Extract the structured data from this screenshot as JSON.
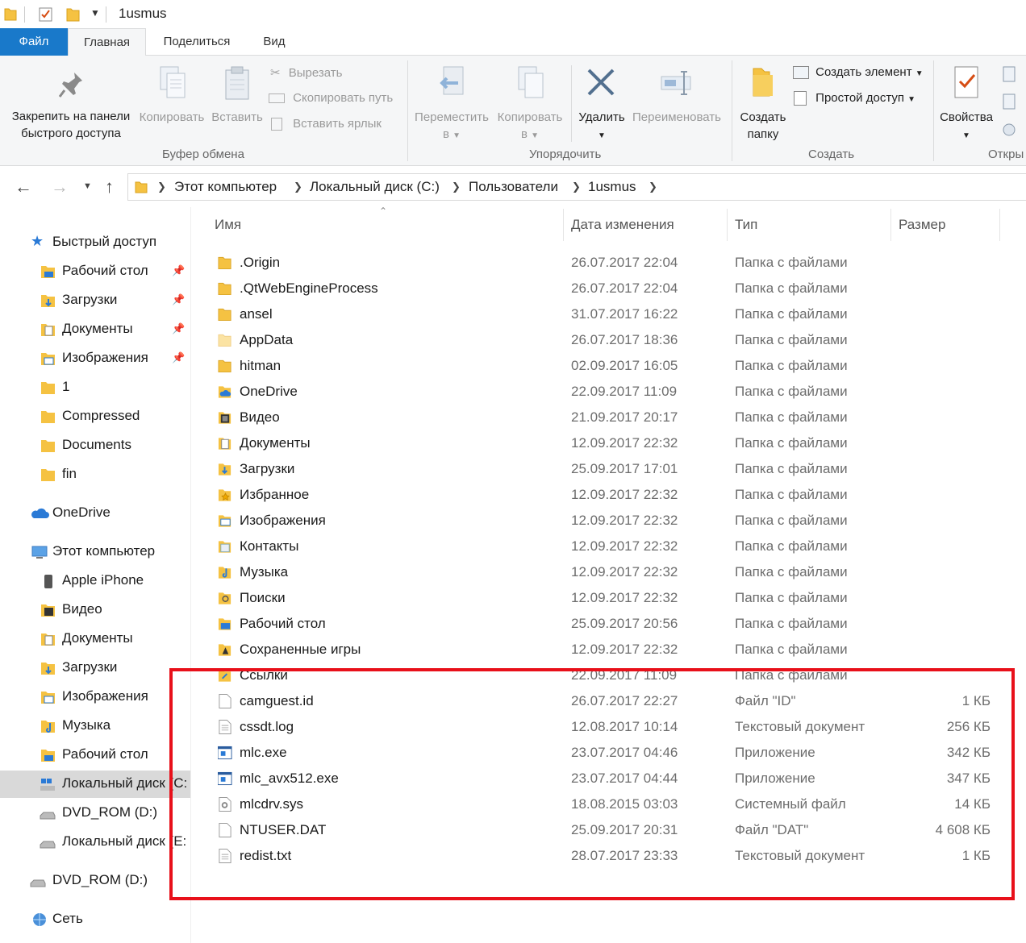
{
  "window": {
    "title": "1usmus"
  },
  "ribbon_tabs": [
    "Файл",
    "Главная",
    "Поделиться",
    "Вид"
  ],
  "ribbon": {
    "pin_label": [
      "Закрепить на панели",
      "быстрого доступа"
    ],
    "copy": "Копировать",
    "paste": "Вставить",
    "cut": "Вырезать",
    "copy_path": "Скопировать путь",
    "paste_shortcut": "Вставить ярлык",
    "group_clipboard": "Буфер обмена",
    "move_to": [
      "Переместить",
      "в"
    ],
    "copy_to": [
      "Копировать",
      "в"
    ],
    "delete": "Удалить",
    "rename": "Переименовать",
    "group_organize": "Упорядочить",
    "new_folder": [
      "Создать",
      "папку"
    ],
    "new_item": "Создать элемент",
    "easy_access": "Простой доступ",
    "group_new": "Создать",
    "properties": "Свойства",
    "group_open": "Откры"
  },
  "breadcrumb": [
    "Этот компьютер",
    "Локальный диск (C:)",
    "Пользователи",
    "1usmus"
  ],
  "nav": {
    "quick_access": "Быстрый доступ",
    "quick_items": [
      "Рабочий стол",
      "Загрузки",
      "Документы",
      "Изображения",
      "1",
      "Compressed",
      "Documents",
      "fin"
    ],
    "onedrive": "OneDrive",
    "this_pc": "Этот компьютер",
    "pc_items": [
      "Apple iPhone",
      "Видео",
      "Документы",
      "Загрузки",
      "Изображения",
      "Музыка",
      "Рабочий стол",
      "Локальный диск (C:",
      "DVD_ROM (D:)",
      "Локальный диск (E:"
    ],
    "dvd": "DVD_ROM (D:)",
    "network": "Сеть"
  },
  "columns": {
    "name": "Имя",
    "date": "Дата изменения",
    "type": "Тип",
    "size": "Размер"
  },
  "files": [
    {
      "name": ".Origin",
      "date": "26.07.2017 22:04",
      "type": "Папка с файлами",
      "size": "",
      "icon": "folder-icon"
    },
    {
      "name": ".QtWebEngineProcess",
      "date": "26.07.2017 22:04",
      "type": "Папка с файлами",
      "size": "",
      "icon": "folder-icon"
    },
    {
      "name": "ansel",
      "date": "31.07.2017 16:22",
      "type": "Папка с файлами",
      "size": "",
      "icon": "folder-icon"
    },
    {
      "name": "AppData",
      "date": "26.07.2017 18:36",
      "type": "Папка с файлами",
      "size": "",
      "icon": "folder-hidden-icon"
    },
    {
      "name": "hitman",
      "date": "02.09.2017 16:05",
      "type": "Папка с файлами",
      "size": "",
      "icon": "folder-icon"
    },
    {
      "name": "OneDrive",
      "date": "22.09.2017 11:09",
      "type": "Папка с файлами",
      "size": "",
      "icon": "onedrive-folder-icon"
    },
    {
      "name": "Видео",
      "date": "21.09.2017 20:17",
      "type": "Папка с файлами",
      "size": "",
      "icon": "video-folder-icon"
    },
    {
      "name": "Документы",
      "date": "12.09.2017 22:32",
      "type": "Папка с файлами",
      "size": "",
      "icon": "documents-folder-icon"
    },
    {
      "name": "Загрузки",
      "date": "25.09.2017 17:01",
      "type": "Папка с файлами",
      "size": "",
      "icon": "downloads-folder-icon"
    },
    {
      "name": "Избранное",
      "date": "12.09.2017 22:32",
      "type": "Папка с файлами",
      "size": "",
      "icon": "favorites-folder-icon"
    },
    {
      "name": "Изображения",
      "date": "12.09.2017 22:32",
      "type": "Папка с файлами",
      "size": "",
      "icon": "pictures-folder-icon"
    },
    {
      "name": "Контакты",
      "date": "12.09.2017 22:32",
      "type": "Папка с файлами",
      "size": "",
      "icon": "contacts-folder-icon"
    },
    {
      "name": "Музыка",
      "date": "12.09.2017 22:32",
      "type": "Папка с файлами",
      "size": "",
      "icon": "music-folder-icon"
    },
    {
      "name": "Поиски",
      "date": "12.09.2017 22:32",
      "type": "Папка с файлами",
      "size": "",
      "icon": "searches-folder-icon"
    },
    {
      "name": "Рабочий стол",
      "date": "25.09.2017 20:56",
      "type": "Папка с файлами",
      "size": "",
      "icon": "desktop-folder-icon"
    },
    {
      "name": "Сохраненные игры",
      "date": "12.09.2017 22:32",
      "type": "Папка с файлами",
      "size": "",
      "icon": "games-folder-icon"
    },
    {
      "name": "Ссылки",
      "date": "22.09.2017 11:09",
      "type": "Папка с файлами",
      "size": "",
      "icon": "links-folder-icon"
    },
    {
      "name": "camguest.id",
      "date": "26.07.2017 22:27",
      "type": "Файл \"ID\"",
      "size": "1 КБ",
      "icon": "file-icon"
    },
    {
      "name": "cssdt.log",
      "date": "12.08.2017 10:14",
      "type": "Текстовый документ",
      "size": "256 КБ",
      "icon": "text-file-icon"
    },
    {
      "name": "mlc.exe",
      "date": "23.07.2017 04:46",
      "type": "Приложение",
      "size": "342 КБ",
      "icon": "exe-icon"
    },
    {
      "name": "mlc_avx512.exe",
      "date": "23.07.2017 04:44",
      "type": "Приложение",
      "size": "347 КБ",
      "icon": "exe-icon"
    },
    {
      "name": "mlcdrv.sys",
      "date": "18.08.2015 03:03",
      "type": "Системный файл",
      "size": "14 КБ",
      "icon": "sys-file-icon"
    },
    {
      "name": "NTUSER.DAT",
      "date": "25.09.2017 20:31",
      "type": "Файл \"DAT\"",
      "size": "4 608 КБ",
      "icon": "file-icon"
    },
    {
      "name": "redist.txt",
      "date": "28.07.2017 23:33",
      "type": "Текстовый документ",
      "size": "1 КБ",
      "icon": "text-file-icon"
    }
  ],
  "colors": {
    "accent": "#1979ca",
    "folder": "#f5c242",
    "highlight_box": "#e8101a",
    "selected_nav": "#d9d9d9"
  }
}
